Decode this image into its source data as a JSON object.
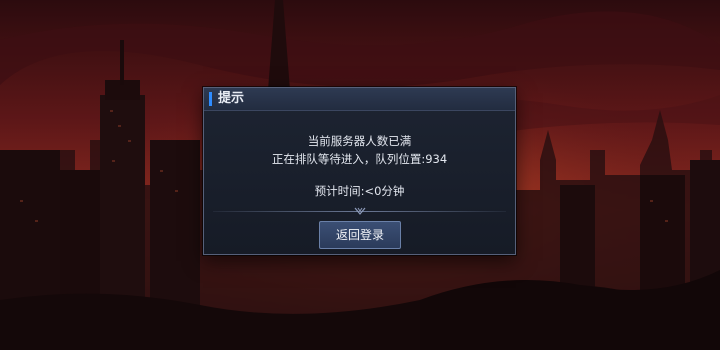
{
  "dialog": {
    "title": "提示",
    "line1": "当前服务器人数已满",
    "line2": "正在排队等待进入，队列位置:934",
    "line3": "预计时间:<0分钟",
    "button_label": "返回登录"
  },
  "colors": {
    "sky_top": "#3a0f12",
    "sky_mid": "#7a1f1c",
    "accent": "#2f8cff",
    "button_bg": "#34476a"
  },
  "icons": [
    "diamond-divider-icon"
  ]
}
